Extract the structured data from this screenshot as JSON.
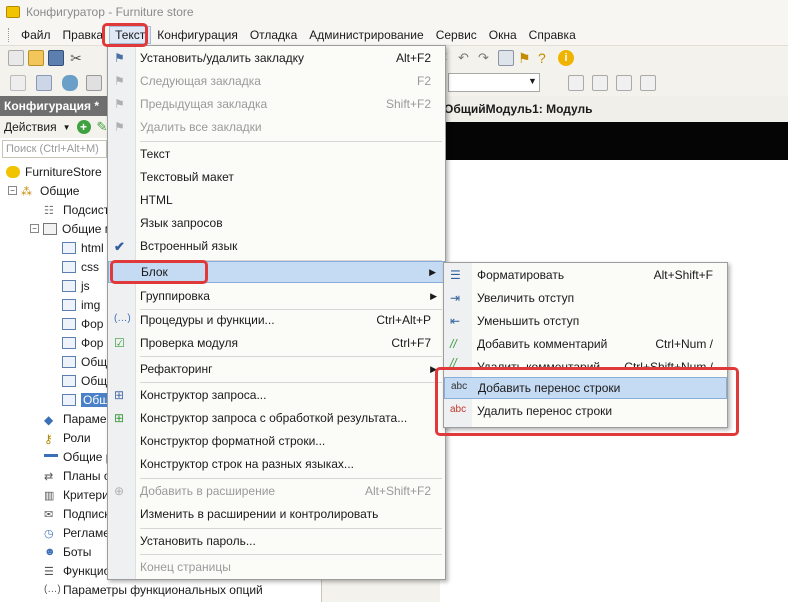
{
  "window": {
    "title": "Конфигуратор - Furniture store"
  },
  "menubar": [
    "Файл",
    "Правка",
    "Текст",
    "Конфигурация",
    "Отладка",
    "Администрирование",
    "Сервис",
    "Окна",
    "Справка"
  ],
  "left_panel": {
    "title": "Конфигурация *",
    "actions_label": "Действия",
    "search_placeholder": "Поиск (Ctrl+Alt+M)",
    "tree": [
      {
        "label": "FurnitureStore",
        "icon": "config-icon"
      },
      {
        "label": "Общие",
        "icon": "common-icon"
      },
      {
        "label": "Подсист",
        "icon": "subsystem-icon"
      },
      {
        "label": "Общие м",
        "icon": "module-icon"
      },
      {
        "label": "html",
        "icon": "module-icon"
      },
      {
        "label": "css",
        "icon": "module-icon"
      },
      {
        "label": "js",
        "icon": "module-icon"
      },
      {
        "label": "img",
        "icon": "module-icon"
      },
      {
        "label": "Фор",
        "icon": "module-icon"
      },
      {
        "label": "Фор",
        "icon": "module-icon"
      },
      {
        "label": "Общ",
        "icon": "module-icon"
      },
      {
        "label": "Общ",
        "icon": "module-icon"
      },
      {
        "label": "Общ",
        "icon": "module-icon"
      },
      {
        "label": "Параме",
        "icon": "params-icon"
      },
      {
        "label": "Роли",
        "icon": "roles-icon"
      },
      {
        "label": "Общие р",
        "icon": "common-attr-icon"
      },
      {
        "label": "Планы о",
        "icon": "exchange-icon"
      },
      {
        "label": "Критери",
        "icon": "criteria-icon"
      },
      {
        "label": "Подписк",
        "icon": "subscriptions-icon"
      },
      {
        "label": "Регламе",
        "icon": "scheduled-icon"
      },
      {
        "label": "Боты",
        "icon": "bots-icon"
      },
      {
        "label": "Функцио",
        "icon": "functional-icon"
      },
      {
        "label": "Параметры функциональных опций",
        "icon": "func-params-icon"
      }
    ]
  },
  "editor": {
    "tab_title": "ОбщийМодуль1: Модуль"
  },
  "text_menu": {
    "items": [
      {
        "label": "Установить/удалить закладку",
        "shortcut": "Alt+F2",
        "disabled": false
      },
      {
        "label": "Следующая закладка",
        "shortcut": "F2",
        "disabled": true
      },
      {
        "label": "Предыдущая закладка",
        "shortcut": "Shift+F2",
        "disabled": true
      },
      {
        "label": "Удалить все закладки",
        "shortcut": "",
        "disabled": true
      },
      {
        "label": "Текст",
        "shortcut": "",
        "disabled": false
      },
      {
        "label": "Текстовый макет",
        "shortcut": "",
        "disabled": false
      },
      {
        "label": "HTML",
        "shortcut": "",
        "disabled": false
      },
      {
        "label": "Язык запросов",
        "shortcut": "",
        "disabled": false
      },
      {
        "label": "Встроенный язык",
        "shortcut": "",
        "disabled": false
      },
      {
        "label": "Блок",
        "shortcut": "",
        "disabled": false
      },
      {
        "label": "Группировка",
        "shortcut": "",
        "disabled": false
      },
      {
        "label": "Процедуры и функции...",
        "shortcut": "Ctrl+Alt+P",
        "disabled": false
      },
      {
        "label": "Проверка модуля",
        "shortcut": "Ctrl+F7",
        "disabled": false
      },
      {
        "label": "Рефакторинг",
        "shortcut": "",
        "disabled": false
      },
      {
        "label": "Конструктор запроса...",
        "shortcut": "",
        "disabled": false
      },
      {
        "label": "Конструктор запроса с обработкой результата...",
        "shortcut": "",
        "disabled": false
      },
      {
        "label": "Конструктор форматной строки...",
        "shortcut": "",
        "disabled": false
      },
      {
        "label": "Конструктор строк на разных языках...",
        "shortcut": "",
        "disabled": false
      },
      {
        "label": "Добавить в расширение",
        "shortcut": "Alt+Shift+F2",
        "disabled": true
      },
      {
        "label": "Изменить в расширении и контролировать",
        "shortcut": "",
        "disabled": false
      },
      {
        "label": "Установить пароль...",
        "shortcut": "",
        "disabled": false
      },
      {
        "label": "Конец страницы",
        "shortcut": "",
        "disabled": true
      }
    ]
  },
  "block_submenu": {
    "items": [
      {
        "label": "Форматировать",
        "shortcut": "Alt+Shift+F"
      },
      {
        "label": "Увеличить отступ",
        "shortcut": ""
      },
      {
        "label": "Уменьшить отступ",
        "shortcut": ""
      },
      {
        "label": "Добавить комментарий",
        "shortcut": "Ctrl+Num /"
      },
      {
        "label": "Удалить комментарий",
        "shortcut": "Ctrl+Shift+Num /"
      },
      {
        "label": "Добавить перенос строки",
        "shortcut": ""
      },
      {
        "label": "Удалить перенос строки",
        "shortcut": ""
      }
    ],
    "icon_text": "abc"
  },
  "colors": {
    "highlight": "#c5daf3",
    "annotation": "#e0393a",
    "selected": "#4a80c8"
  }
}
